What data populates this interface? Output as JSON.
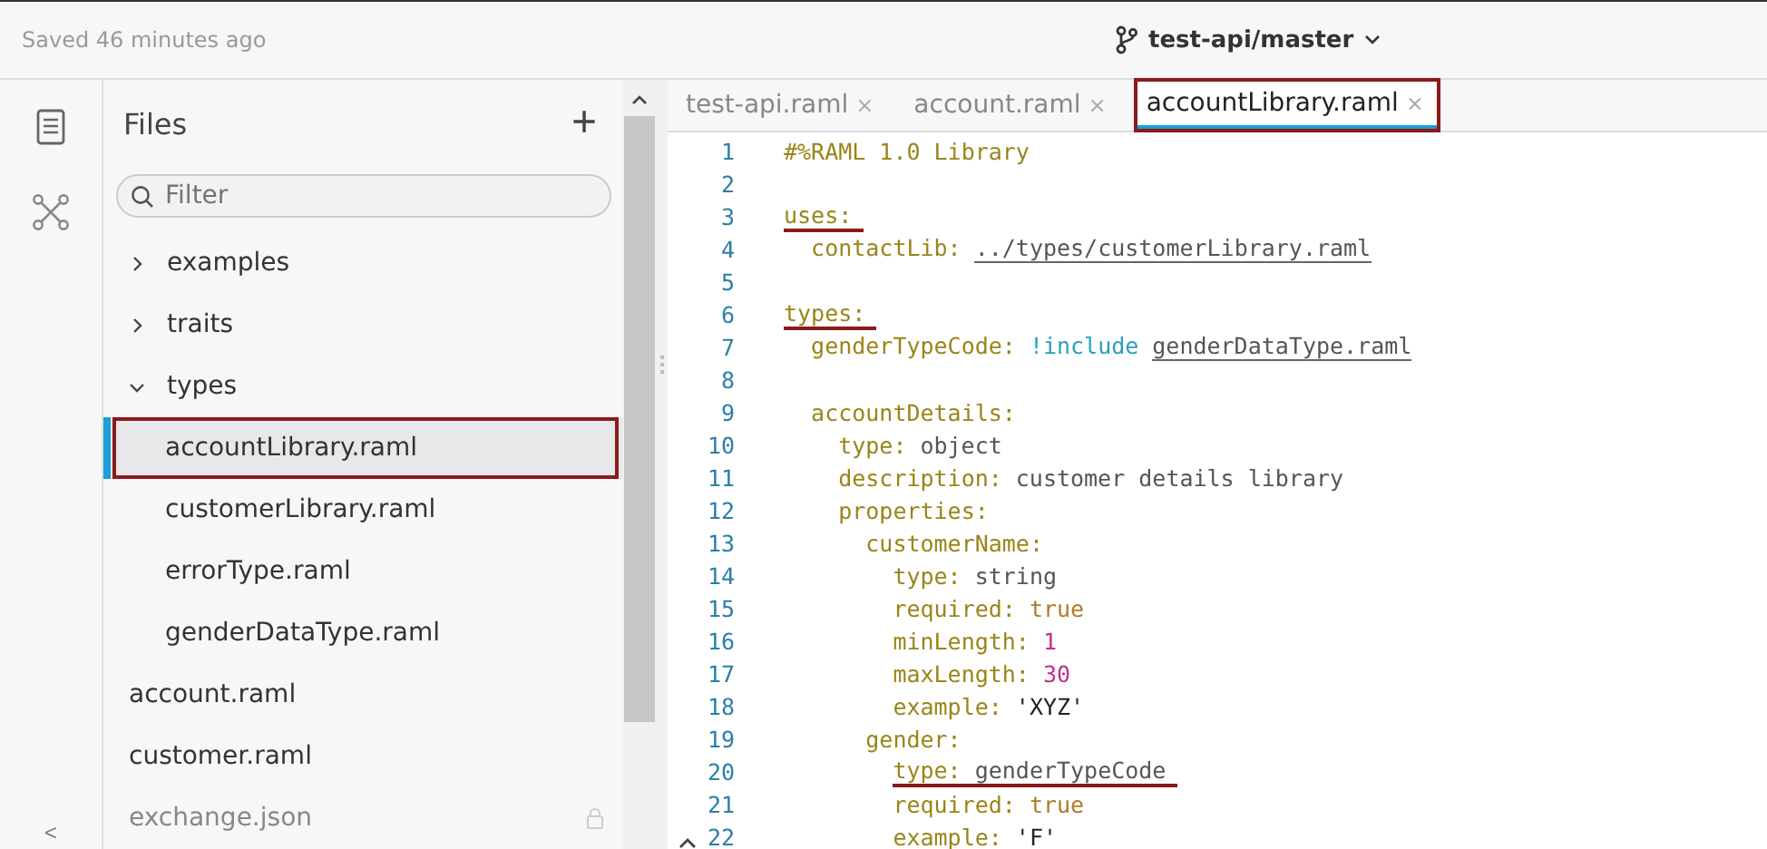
{
  "top_bar": {
    "save_status": "Saved 46 minutes ago",
    "branch": "test-api/master"
  },
  "rail": {
    "collapse": "<"
  },
  "files_panel": {
    "title": "Files",
    "add": "+",
    "filter": {
      "placeholder": "Filter"
    },
    "tree": [
      {
        "kind": "folder",
        "name": "examples",
        "expanded": false,
        "selected": false,
        "highlighted": false
      },
      {
        "kind": "folder",
        "name": "traits",
        "expanded": false,
        "selected": false,
        "highlighted": false
      },
      {
        "kind": "folder",
        "name": "types",
        "expanded": true,
        "selected": false,
        "highlighted": false,
        "children": [
          {
            "kind": "file",
            "name": "accountLibrary.raml",
            "selected": true,
            "highlighted": true
          },
          {
            "kind": "file",
            "name": "customerLibrary.raml",
            "selected": false,
            "highlighted": false
          },
          {
            "kind": "file",
            "name": "errorType.raml",
            "selected": false,
            "highlighted": false
          },
          {
            "kind": "file",
            "name": "genderDataType.raml",
            "selected": false,
            "highlighted": false
          }
        ]
      },
      {
        "kind": "file",
        "name": "account.raml",
        "selected": false,
        "highlighted": false
      },
      {
        "kind": "file",
        "name": "customer.raml",
        "selected": false,
        "highlighted": false
      },
      {
        "kind": "file",
        "name": "exchange.json",
        "selected": false,
        "highlighted": false,
        "locked": true
      }
    ]
  },
  "tabs": [
    {
      "label": "test-api.raml",
      "close": "×",
      "selected": false,
      "highlighted": false
    },
    {
      "label": "account.raml",
      "close": "×",
      "selected": false,
      "highlighted": false
    },
    {
      "label": "accountLibrary.raml",
      "close": "×",
      "selected": true,
      "highlighted": true
    }
  ],
  "editor": {
    "lines": [
      {
        "number": "1",
        "tokens": [
          {
            "kind": "key",
            "text": "#%RAML 1.0 Library"
          }
        ]
      },
      {
        "number": "2"
      },
      {
        "number": "3",
        "highlighted": true,
        "tokens": [
          {
            "kind": "key",
            "text": "uses:"
          }
        ],
        "children": [
          {
            "number": "4",
            "tokens": [
              {
                "kind": "key",
                "text": "contactLib:"
              },
              {
                "kind": "path",
                "text": "../types/customerLibrary.raml"
              }
            ]
          }
        ]
      },
      {
        "number": "5"
      },
      {
        "number": "6",
        "highlighted": true,
        "tokens": [
          {
            "kind": "key",
            "text": "types:"
          }
        ],
        "children": [
          {
            "number": "7",
            "tokens": [
              {
                "kind": "key",
                "text": "genderTypeCode:"
              },
              {
                "kind": "tag",
                "text": "!include"
              },
              {
                "kind": "path",
                "text": "genderDataType.raml"
              }
            ]
          },
          {
            "number": "8"
          },
          {
            "number": "9",
            "tokens": [
              {
                "kind": "key",
                "text": "accountDetails:"
              }
            ],
            "children": [
              {
                "number": "10",
                "tokens": [
                  {
                    "kind": "key",
                    "text": "type:"
                  },
                  {
                    "kind": "value",
                    "text": "object"
                  }
                ]
              },
              {
                "number": "11",
                "tokens": [
                  {
                    "kind": "key",
                    "text": "description:"
                  },
                  {
                    "kind": "value",
                    "text": "customer details library"
                  }
                ]
              },
              {
                "number": "12",
                "tokens": [
                  {
                    "kind": "key",
                    "text": "properties:"
                  }
                ],
                "children": [
                  {
                    "number": "13",
                    "tokens": [
                      {
                        "kind": "key",
                        "text": "customerName:"
                      }
                    ],
                    "children": [
                      {
                        "number": "14",
                        "tokens": [
                          {
                            "kind": "key",
                            "text": "type:"
                          },
                          {
                            "kind": "value",
                            "text": "string"
                          }
                        ]
                      },
                      {
                        "number": "15",
                        "tokens": [
                          {
                            "kind": "key",
                            "text": "required:"
                          },
                          {
                            "kind": "bool",
                            "text": "true"
                          }
                        ]
                      },
                      {
                        "number": "16",
                        "tokens": [
                          {
                            "kind": "key",
                            "text": "minLength:"
                          },
                          {
                            "kind": "number",
                            "text": "1"
                          }
                        ]
                      },
                      {
                        "number": "17",
                        "tokens": [
                          {
                            "kind": "key",
                            "text": "maxLength:"
                          },
                          {
                            "kind": "number",
                            "text": "30"
                          }
                        ]
                      },
                      {
                        "number": "18",
                        "tokens": [
                          {
                            "kind": "key",
                            "text": "example:"
                          },
                          {
                            "kind": "string",
                            "text": "'XYZ'"
                          }
                        ]
                      }
                    ]
                  },
                  {
                    "number": "19",
                    "tokens": [
                      {
                        "kind": "key",
                        "text": "gender:"
                      }
                    ],
                    "children": [
                      {
                        "number": "20",
                        "highlighted": true,
                        "tokens": [
                          {
                            "kind": "key",
                            "text": "type:"
                          },
                          {
                            "kind": "value",
                            "text": "genderTypeCode"
                          }
                        ]
                      },
                      {
                        "number": "21",
                        "tokens": [
                          {
                            "kind": "key",
                            "text": "required:"
                          },
                          {
                            "kind": "bool",
                            "text": "true"
                          }
                        ]
                      },
                      {
                        "number": "22",
                        "tokens": [
                          {
                            "kind": "key",
                            "text": "example:"
                          },
                          {
                            "kind": "string",
                            "text": "'F'"
                          }
                        ]
                      }
                    ]
                  }
                ]
              }
            ]
          }
        ]
      }
    ]
  }
}
